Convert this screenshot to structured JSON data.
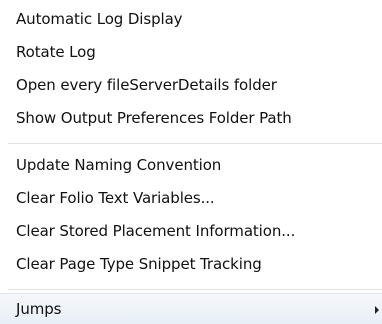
{
  "menu": {
    "items": [
      {
        "label": "Automatic Log Display"
      },
      {
        "label": "Rotate Log"
      },
      {
        "label": "Open every fileServerDetails folder"
      },
      {
        "label": "Show Output Preferences Folder Path"
      },
      {
        "label": "Update Naming Convention"
      },
      {
        "label": "Clear Folio Text Variables..."
      },
      {
        "label": "Clear Stored Placement Information..."
      },
      {
        "label": "Clear Page Type Snippet Tracking"
      },
      {
        "label": "Jumps"
      }
    ]
  },
  "icons": {
    "submenu_arrow": "chevron-right-icon"
  }
}
